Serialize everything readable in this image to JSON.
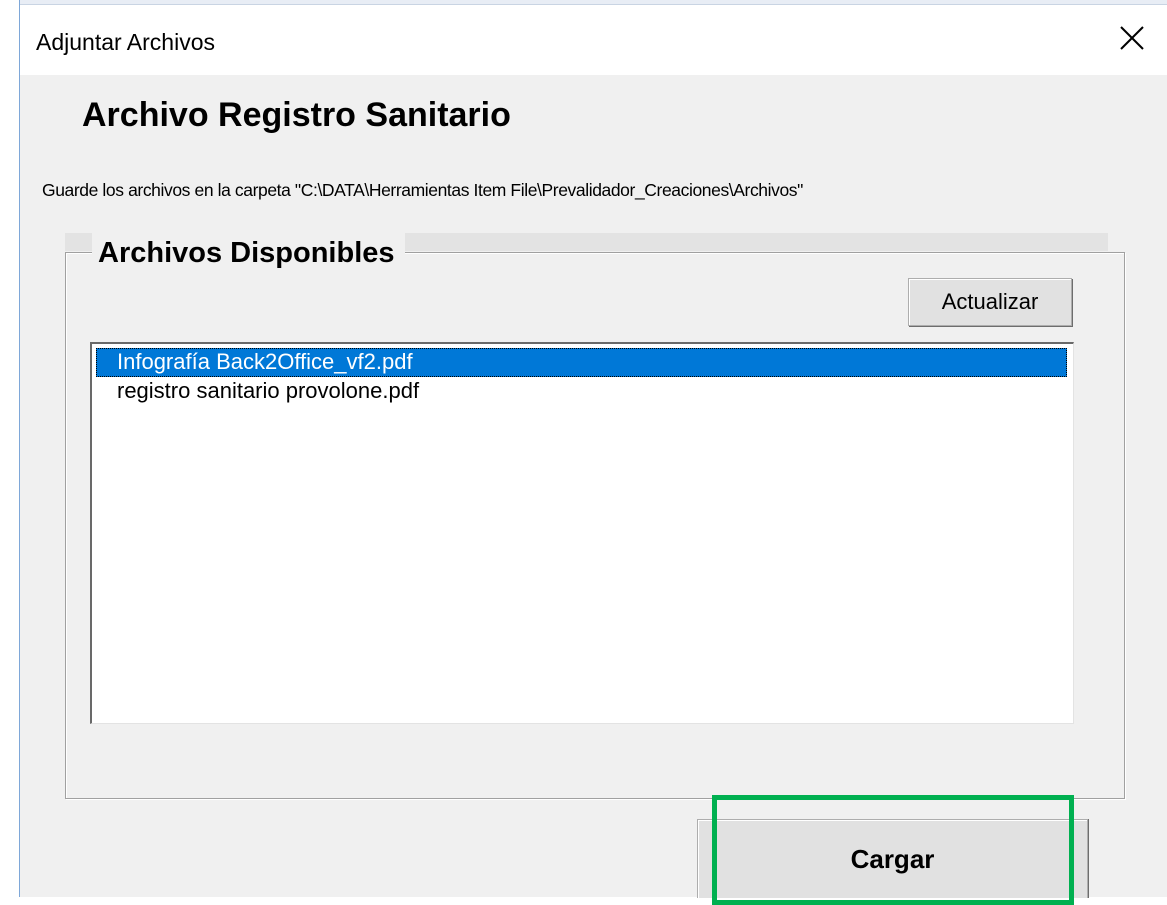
{
  "window": {
    "title": "Adjuntar Archivos",
    "close_icon": "close-icon"
  },
  "heading": "Archivo Registro Sanitario",
  "instruction": "Guarde los archivos en la carpeta \"C:\\DATA\\Herramientas Item File\\Prevalidador_Creaciones\\Archivos\"",
  "group": {
    "label": "Archivos Disponibles",
    "refresh_label": "Actualizar",
    "files": [
      {
        "name": "Infografía Back2Office_vf2.pdf",
        "selected": true
      },
      {
        "name": "registro sanitario provolone.pdf",
        "selected": false
      }
    ]
  },
  "actions": {
    "upload_label": "Cargar"
  },
  "colors": {
    "selection": "#0078d7",
    "highlight_outline": "#00b050",
    "dialog_background": "#f0f0f0"
  }
}
